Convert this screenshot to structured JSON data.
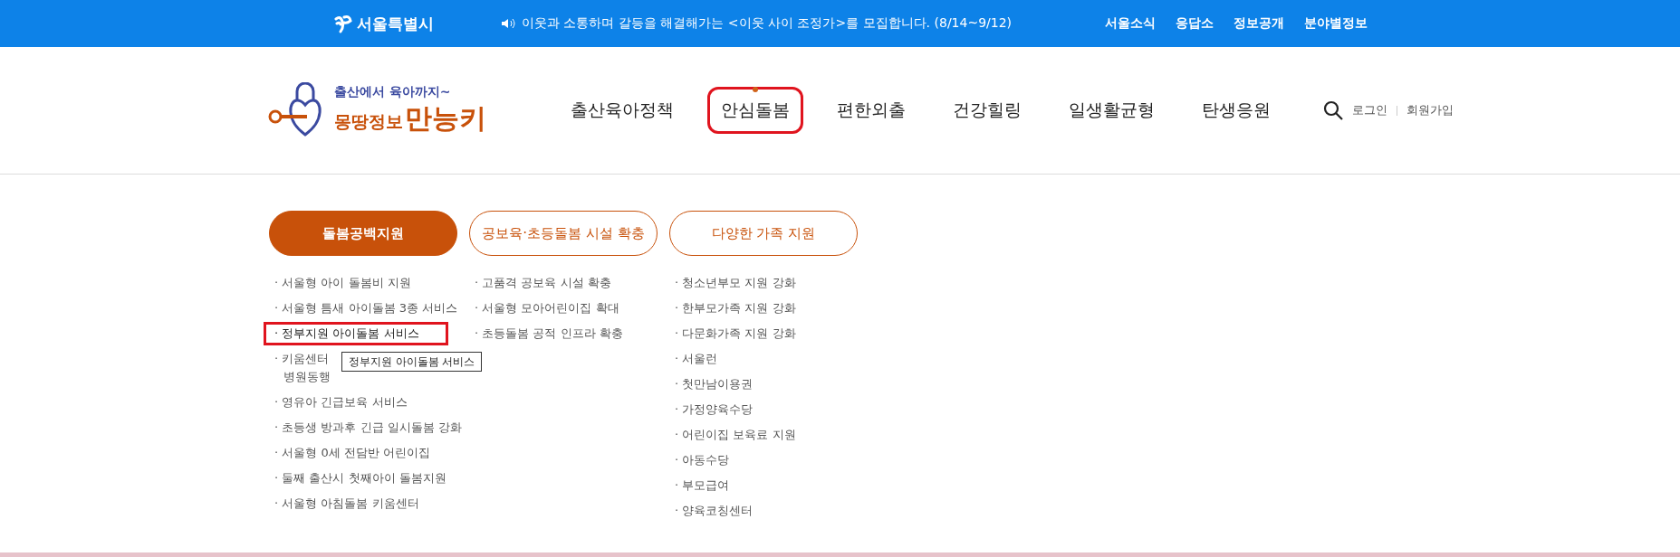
{
  "top_bar": {
    "city_logo": "서울특별시",
    "notice": "이웃과 소통하며 갈등을 해결해가는 <이웃 사이 조정가>를 모집합니다. (8/14~9/12)",
    "links": [
      "서울소식",
      "응답소",
      "정보공개",
      "분야별정보"
    ]
  },
  "header": {
    "logo": {
      "tagline": "출산에서 육아까지~",
      "name_part": "몽땅정보",
      "name_accent": "만능키"
    },
    "nav": [
      {
        "label": "출산육아정책",
        "selected": false,
        "highlighted": false
      },
      {
        "label": "안심돌봄",
        "selected": true,
        "highlighted": true
      },
      {
        "label": "편한외출",
        "selected": false,
        "highlighted": false
      },
      {
        "label": "건강힐링",
        "selected": false,
        "highlighted": false
      },
      {
        "label": "일생활균형",
        "selected": false,
        "highlighted": false
      },
      {
        "label": "탄생응원",
        "selected": false,
        "highlighted": false
      }
    ],
    "login": "로그인",
    "signup": "회원가입"
  },
  "submenu": {
    "columns": [
      {
        "title": "돌봄공백지원",
        "selected": true,
        "items": [
          {
            "lines": [
              "· 서울형 아이 돌봄비 지원"
            ],
            "highlighted": false
          },
          {
            "lines": [
              "· 서울형 틈새 아이돌봄 3종 서비스"
            ],
            "highlighted": false
          },
          {
            "lines": [
              "· 정부지원 아이돌봄 서비스"
            ],
            "highlighted": true
          },
          {
            "lines": [
              "· 키움센터",
              "병원동행"
            ],
            "highlighted": false,
            "tooltip": "정부지원 아이돌봄 서비스"
          },
          {
            "lines": [
              "· 영유아 긴급보육 서비스"
            ],
            "highlighted": false
          },
          {
            "lines": [
              "· 초등생 방과후 긴급 일시돌봄 강화"
            ],
            "highlighted": false
          },
          {
            "lines": [
              "· 서울형 0세 전담반 어린이집"
            ],
            "highlighted": false
          },
          {
            "lines": [
              "· 둘째 출산시 첫째아이 돌봄지원"
            ],
            "highlighted": false
          },
          {
            "lines": [
              "· 서울형 아침돌봄 키움센터"
            ],
            "highlighted": false
          }
        ]
      },
      {
        "title": "공보육·초등돌봄 시설 확충",
        "selected": false,
        "items": [
          {
            "lines": [
              "· 고품격 공보육 시설 확충"
            ],
            "highlighted": false
          },
          {
            "lines": [
              "· 서울형 모아어린이집 확대"
            ],
            "highlighted": false
          },
          {
            "lines": [
              "· 초등돌봄 공적 인프라 확충"
            ],
            "highlighted": false
          }
        ]
      },
      {
        "title": "다양한 가족 지원",
        "selected": false,
        "items": [
          {
            "lines": [
              "· 청소년부모 지원 강화"
            ],
            "highlighted": false
          },
          {
            "lines": [
              "· 한부모가족 지원 강화"
            ],
            "highlighted": false
          },
          {
            "lines": [
              "· 다문화가족 지원 강화"
            ],
            "highlighted": false
          },
          {
            "lines": [
              "· 서울런"
            ],
            "highlighted": false
          },
          {
            "lines": [
              "· 첫만남이용권"
            ],
            "highlighted": false
          },
          {
            "lines": [
              "· 가정양육수당"
            ],
            "highlighted": false
          },
          {
            "lines": [
              "· 어린이집 보육료 지원"
            ],
            "highlighted": false
          },
          {
            "lines": [
              "· 아동수당"
            ],
            "highlighted": false
          },
          {
            "lines": [
              "· 부모급여"
            ],
            "highlighted": false
          },
          {
            "lines": [
              "· 양육코칭센터"
            ],
            "highlighted": false
          }
        ]
      }
    ]
  }
}
